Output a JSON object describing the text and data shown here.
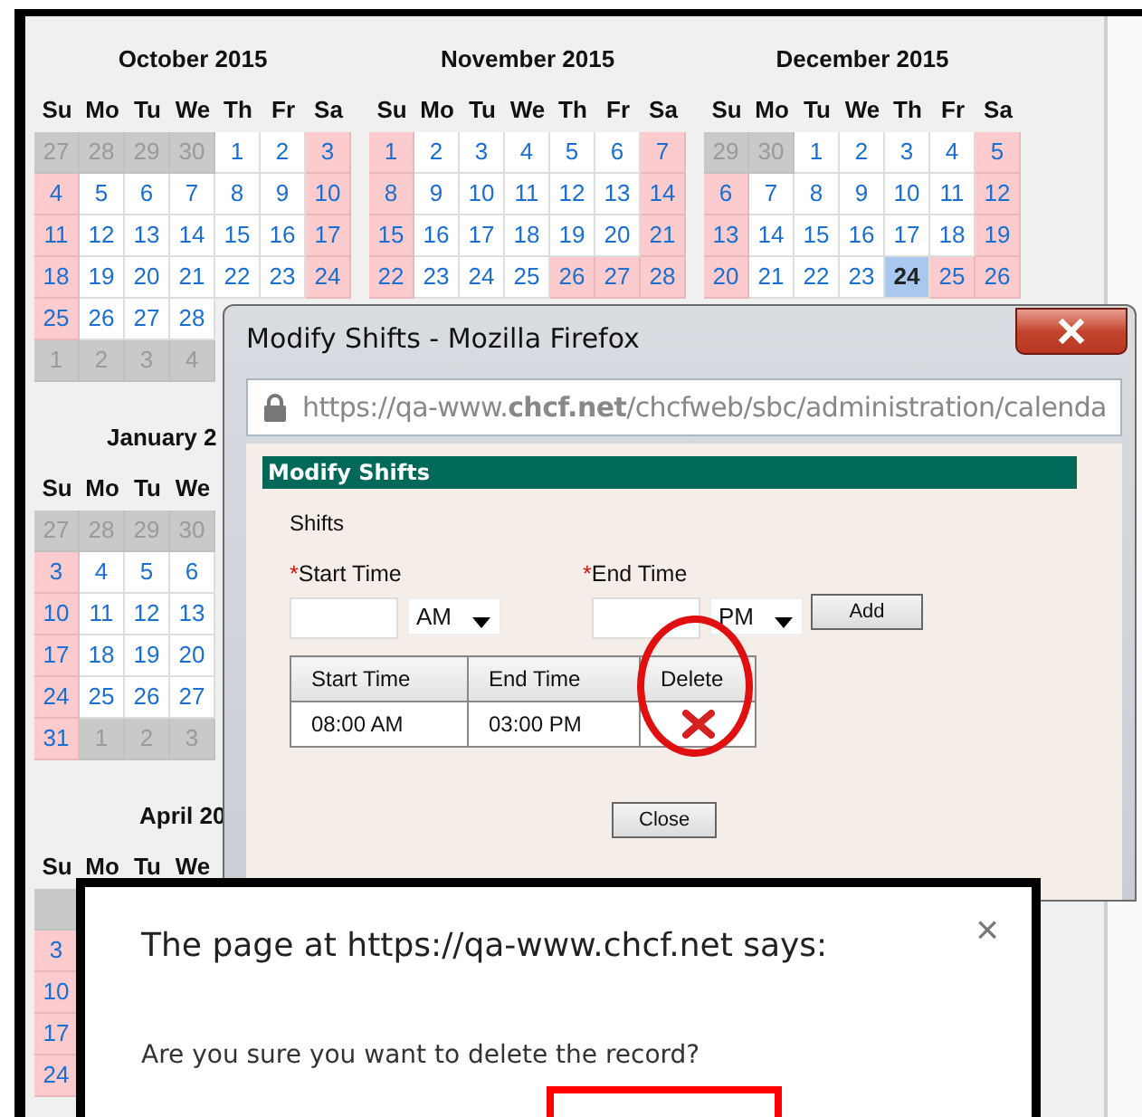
{
  "calendar_rows": [
    [
      {
        "title": "October 2015",
        "weekdays": [
          "Su",
          "Mo",
          "Tu",
          "We",
          "Th",
          "Fr",
          "Sa"
        ],
        "weeks": [
          [
            {
              "day": "27",
              "kind": "other"
            },
            {
              "day": "28",
              "kind": "other"
            },
            {
              "day": "29",
              "kind": "other"
            },
            {
              "day": "30",
              "kind": "other"
            },
            {
              "day": "1",
              "kind": "weekday"
            },
            {
              "day": "2",
              "kind": "weekday"
            },
            {
              "day": "3",
              "kind": "weekend"
            }
          ],
          [
            {
              "day": "4",
              "kind": "weekend"
            },
            {
              "day": "5",
              "kind": "weekday"
            },
            {
              "day": "6",
              "kind": "weekday"
            },
            {
              "day": "7",
              "kind": "weekday"
            },
            {
              "day": "8",
              "kind": "weekday"
            },
            {
              "day": "9",
              "kind": "weekday"
            },
            {
              "day": "10",
              "kind": "weekend"
            }
          ],
          [
            {
              "day": "11",
              "kind": "weekend"
            },
            {
              "day": "12",
              "kind": "weekday"
            },
            {
              "day": "13",
              "kind": "weekday"
            },
            {
              "day": "14",
              "kind": "weekday"
            },
            {
              "day": "15",
              "kind": "weekday"
            },
            {
              "day": "16",
              "kind": "weekday"
            },
            {
              "day": "17",
              "kind": "weekend"
            }
          ],
          [
            {
              "day": "18",
              "kind": "weekend"
            },
            {
              "day": "19",
              "kind": "weekday"
            },
            {
              "day": "20",
              "kind": "weekday"
            },
            {
              "day": "21",
              "kind": "weekday"
            },
            {
              "day": "22",
              "kind": "weekday"
            },
            {
              "day": "23",
              "kind": "weekday"
            },
            {
              "day": "24",
              "kind": "weekend"
            }
          ],
          [
            {
              "day": "25",
              "kind": "weekend"
            },
            {
              "day": "26",
              "kind": "weekday"
            },
            {
              "day": "27",
              "kind": "weekday"
            },
            {
              "day": "28",
              "kind": "weekday"
            }
          ],
          [
            {
              "day": "1",
              "kind": "other"
            },
            {
              "day": "2",
              "kind": "other"
            },
            {
              "day": "3",
              "kind": "other"
            },
            {
              "day": "4",
              "kind": "other"
            }
          ]
        ]
      },
      {
        "title": "November 2015",
        "weekdays": [
          "Su",
          "Mo",
          "Tu",
          "We",
          "Th",
          "Fr",
          "Sa"
        ],
        "weeks": [
          [
            {
              "day": "1",
              "kind": "weekend"
            },
            {
              "day": "2",
              "kind": "weekday"
            },
            {
              "day": "3",
              "kind": "weekday"
            },
            {
              "day": "4",
              "kind": "weekday"
            },
            {
              "day": "5",
              "kind": "weekday"
            },
            {
              "day": "6",
              "kind": "weekday"
            },
            {
              "day": "7",
              "kind": "weekend"
            }
          ],
          [
            {
              "day": "8",
              "kind": "weekend"
            },
            {
              "day": "9",
              "kind": "weekday"
            },
            {
              "day": "10",
              "kind": "weekday"
            },
            {
              "day": "11",
              "kind": "weekday"
            },
            {
              "day": "12",
              "kind": "weekday"
            },
            {
              "day": "13",
              "kind": "weekday"
            },
            {
              "day": "14",
              "kind": "weekend"
            }
          ],
          [
            {
              "day": "15",
              "kind": "weekend"
            },
            {
              "day": "16",
              "kind": "weekday"
            },
            {
              "day": "17",
              "kind": "weekday"
            },
            {
              "day": "18",
              "kind": "weekday"
            },
            {
              "day": "19",
              "kind": "weekday"
            },
            {
              "day": "20",
              "kind": "weekday"
            },
            {
              "day": "21",
              "kind": "weekend"
            }
          ],
          [
            {
              "day": "22",
              "kind": "weekend"
            },
            {
              "day": "23",
              "kind": "weekday"
            },
            {
              "day": "24",
              "kind": "weekday"
            },
            {
              "day": "25",
              "kind": "weekday"
            },
            {
              "day": "26",
              "kind": "weekend"
            },
            {
              "day": "27",
              "kind": "weekend"
            },
            {
              "day": "28",
              "kind": "weekend"
            }
          ]
        ]
      },
      {
        "title": "December 2015",
        "weekdays": [
          "Su",
          "Mo",
          "Tu",
          "We",
          "Th",
          "Fr",
          "Sa"
        ],
        "weeks": [
          [
            {
              "day": "29",
              "kind": "other"
            },
            {
              "day": "30",
              "kind": "other"
            },
            {
              "day": "1",
              "kind": "weekday"
            },
            {
              "day": "2",
              "kind": "weekday"
            },
            {
              "day": "3",
              "kind": "weekday"
            },
            {
              "day": "4",
              "kind": "weekday"
            },
            {
              "day": "5",
              "kind": "weekend"
            }
          ],
          [
            {
              "day": "6",
              "kind": "weekend"
            },
            {
              "day": "7",
              "kind": "weekday"
            },
            {
              "day": "8",
              "kind": "weekday"
            },
            {
              "day": "9",
              "kind": "weekday"
            },
            {
              "day": "10",
              "kind": "weekday"
            },
            {
              "day": "11",
              "kind": "weekday"
            },
            {
              "day": "12",
              "kind": "weekend"
            }
          ],
          [
            {
              "day": "13",
              "kind": "weekend"
            },
            {
              "day": "14",
              "kind": "weekday"
            },
            {
              "day": "15",
              "kind": "weekday"
            },
            {
              "day": "16",
              "kind": "weekday"
            },
            {
              "day": "17",
              "kind": "weekday"
            },
            {
              "day": "18",
              "kind": "weekday"
            },
            {
              "day": "19",
              "kind": "weekend"
            }
          ],
          [
            {
              "day": "20",
              "kind": "weekend"
            },
            {
              "day": "21",
              "kind": "weekday"
            },
            {
              "day": "22",
              "kind": "weekday"
            },
            {
              "day": "23",
              "kind": "weekday"
            },
            {
              "day": "24",
              "kind": "today"
            },
            {
              "day": "25",
              "kind": "weekend"
            },
            {
              "day": "26",
              "kind": "weekend"
            }
          ]
        ]
      }
    ],
    [
      {
        "title": "January 2",
        "weekdays": [
          "Su",
          "Mo",
          "Tu",
          "We"
        ],
        "weeks": [
          [
            {
              "day": "27",
              "kind": "other"
            },
            {
              "day": "28",
              "kind": "other"
            },
            {
              "day": "29",
              "kind": "other"
            },
            {
              "day": "30",
              "kind": "other"
            }
          ],
          [
            {
              "day": "3",
              "kind": "weekend"
            },
            {
              "day": "4",
              "kind": "weekday"
            },
            {
              "day": "5",
              "kind": "weekday"
            },
            {
              "day": "6",
              "kind": "weekday"
            }
          ],
          [
            {
              "day": "10",
              "kind": "weekend"
            },
            {
              "day": "11",
              "kind": "weekday"
            },
            {
              "day": "12",
              "kind": "weekday"
            },
            {
              "day": "13",
              "kind": "weekday"
            }
          ],
          [
            {
              "day": "17",
              "kind": "weekend"
            },
            {
              "day": "18",
              "kind": "weekday"
            },
            {
              "day": "19",
              "kind": "weekday"
            },
            {
              "day": "20",
              "kind": "weekday"
            }
          ],
          [
            {
              "day": "24",
              "kind": "weekend"
            },
            {
              "day": "25",
              "kind": "weekday"
            },
            {
              "day": "26",
              "kind": "weekday"
            },
            {
              "day": "27",
              "kind": "weekday"
            }
          ],
          [
            {
              "day": "31",
              "kind": "weekend"
            },
            {
              "day": "1",
              "kind": "other"
            },
            {
              "day": "2",
              "kind": "other"
            },
            {
              "day": "3",
              "kind": "other"
            }
          ]
        ]
      }
    ],
    [
      {
        "title": "April 20",
        "weekdays": [
          "Su",
          "Mo",
          "Tu",
          "We"
        ],
        "weeks": [
          [
            {
              "kind": "other"
            }
          ],
          [
            {
              "day": "3",
              "kind": "weekend"
            }
          ],
          [
            {
              "day": "10",
              "kind": "weekend"
            }
          ],
          [
            {
              "day": "17",
              "kind": "weekend"
            }
          ],
          [
            {
              "day": "24",
              "kind": "weekend"
            }
          ]
        ]
      }
    ]
  ],
  "popup": {
    "title": "Modify Shifts - Mozilla Firefox",
    "url": "https://qa-www.**chcf.net**/chcfweb/sbc/administration/calenda",
    "header": "Modify Shifts",
    "section": "Shifts",
    "start_label": "Start Time",
    "end_label": "End Time",
    "required_mark": "*",
    "start_period": "AM",
    "end_period": "PM",
    "add_button": "Add",
    "table": {
      "columns": [
        "Start Time",
        "End Time",
        "Delete"
      ],
      "rows": [
        {
          "start": "08:00 AM",
          "end": "03:00 PM"
        }
      ]
    },
    "close_button": "Close"
  },
  "dialog": {
    "title": "The page at https://qa-www.chcf.net says:",
    "close": "×",
    "message": "Are you sure you want to delete the record?"
  }
}
